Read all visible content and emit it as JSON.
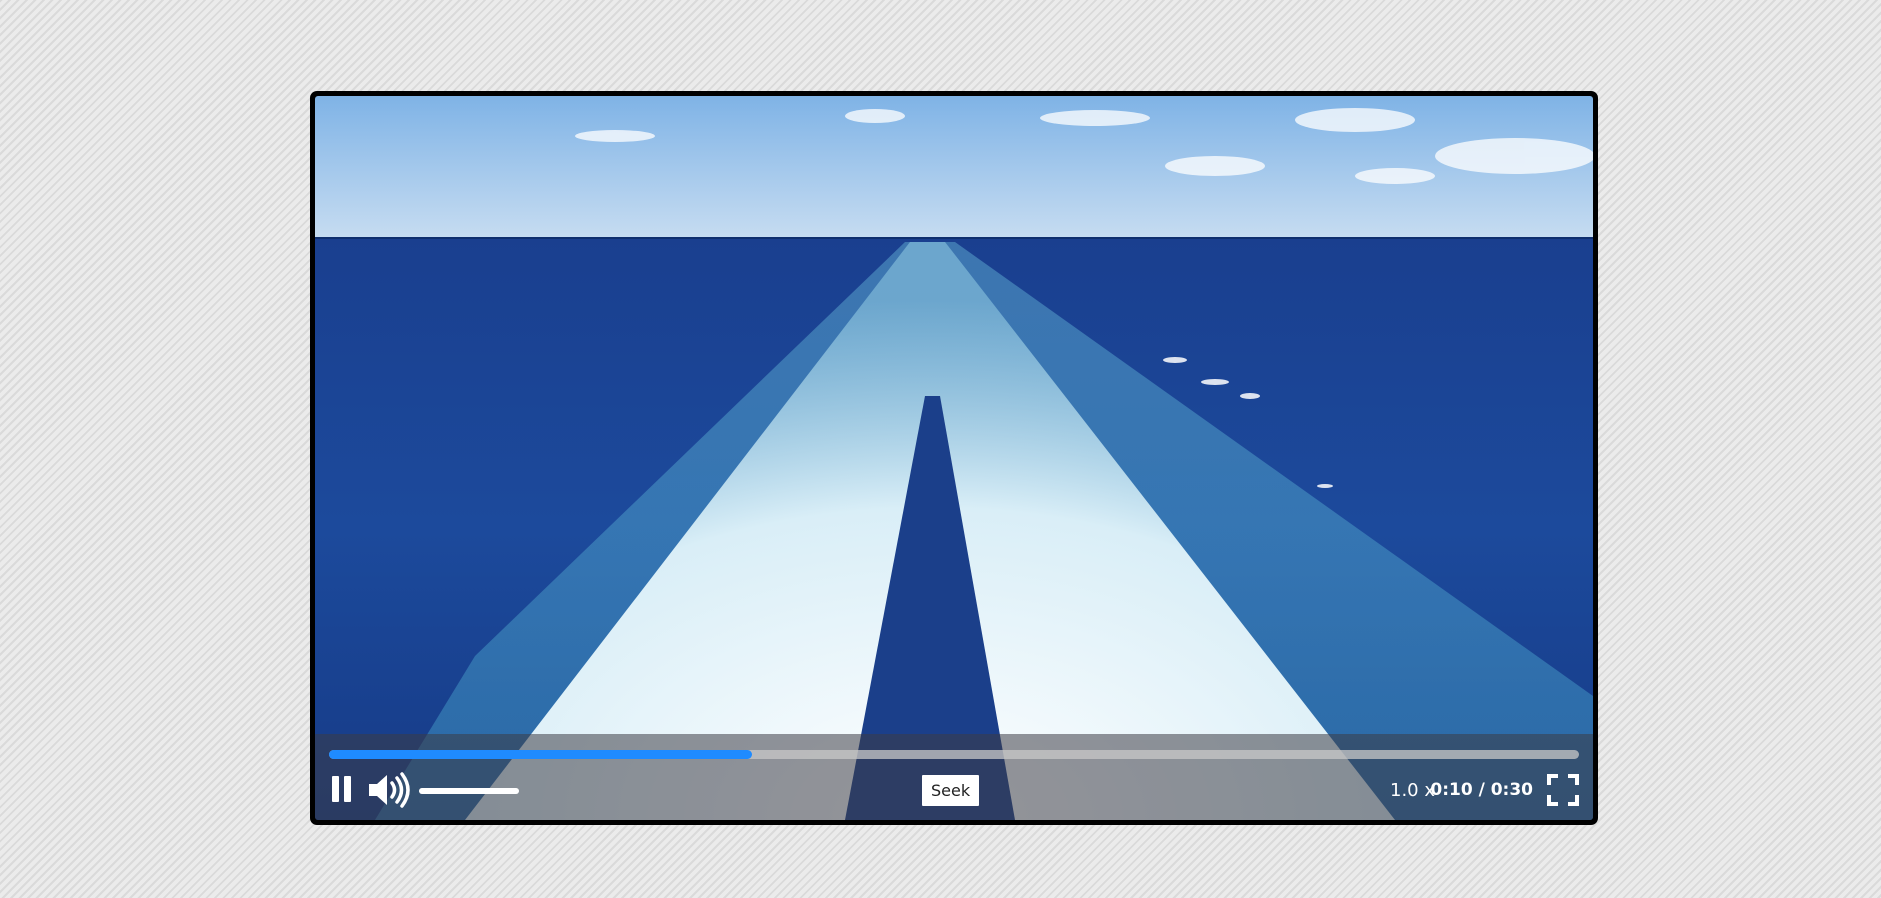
{
  "player": {
    "progress_fraction": 0.3387,
    "volume_fraction": 1.0,
    "seek_tooltip": "Seek",
    "speed_label": "1.0 x",
    "time_current": "0:10",
    "time_separator": " / ",
    "time_total": "0:30",
    "accent_color": "#1f8bff",
    "icons": [
      "pause-icon",
      "volume-high-icon",
      "fullscreen-icon"
    ]
  }
}
